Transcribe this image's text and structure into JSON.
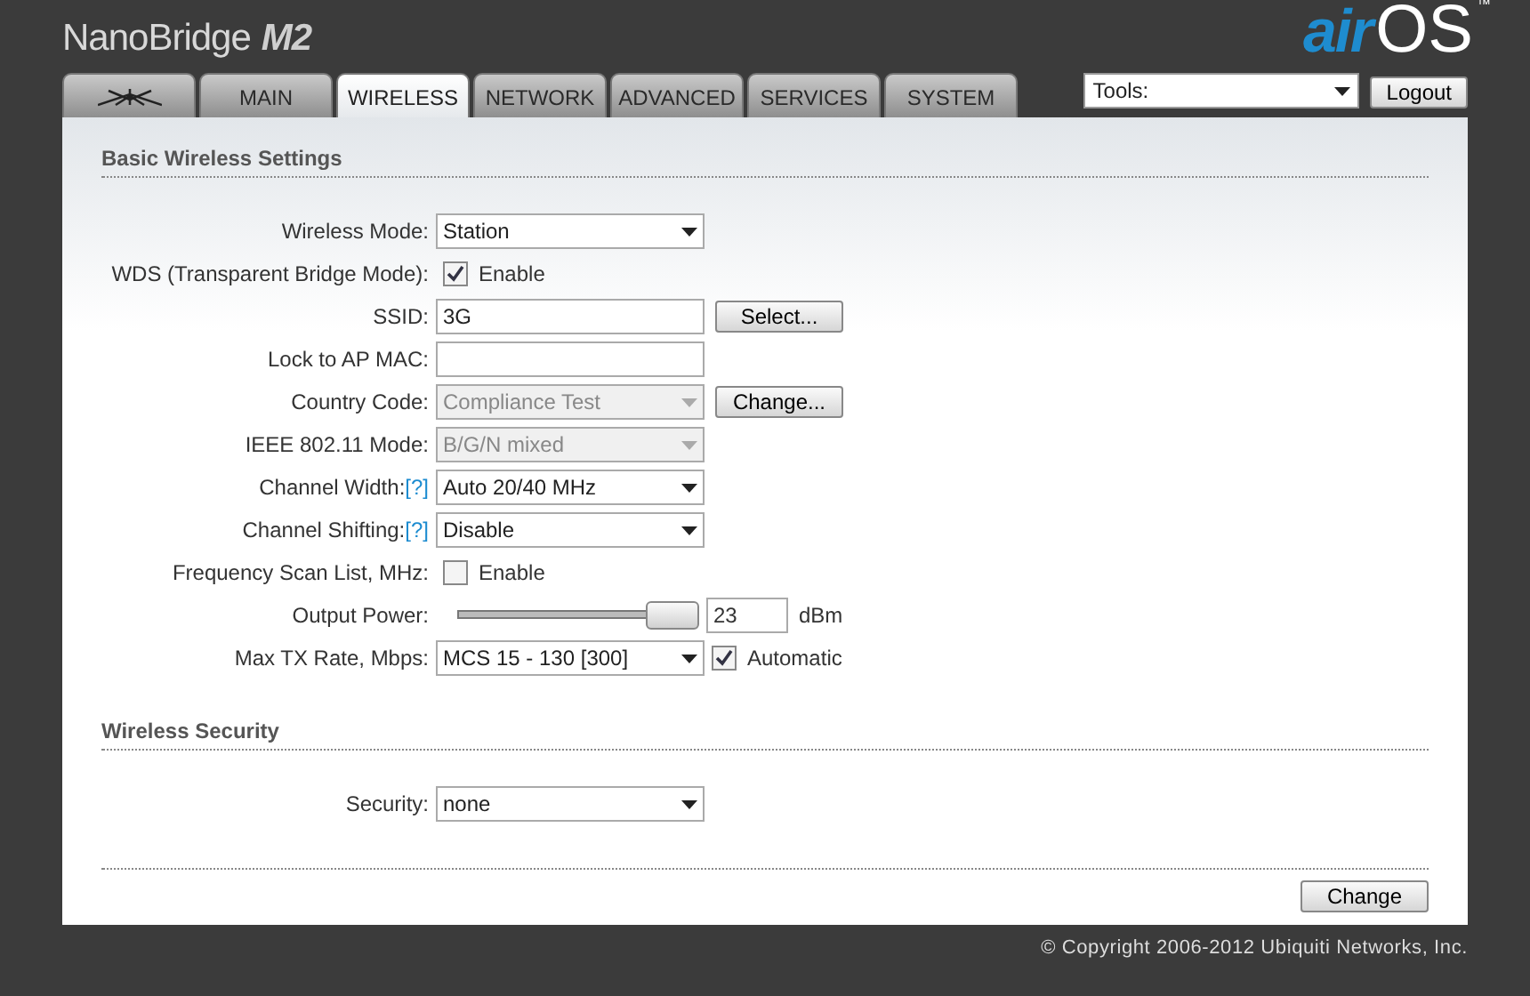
{
  "header": {
    "product": "NanoBridge",
    "model": "M2",
    "logo_air": "air",
    "logo_os": "OS",
    "trademark": "™"
  },
  "tabs": [
    {
      "kind": "logo",
      "selected": false
    },
    {
      "kind": "text",
      "label": "MAIN",
      "selected": false
    },
    {
      "kind": "text",
      "label": "WIRELESS",
      "selected": true
    },
    {
      "kind": "text",
      "label": "NETWORK",
      "selected": false
    },
    {
      "kind": "text",
      "label": "ADVANCED",
      "selected": false
    },
    {
      "kind": "text",
      "label": "SERVICES",
      "selected": false
    },
    {
      "kind": "text",
      "label": "SYSTEM",
      "selected": false
    }
  ],
  "tools": {
    "value": "Tools:",
    "logout": "Logout"
  },
  "sections": [
    {
      "title": "Basic Wireless Settings",
      "rows": [
        {
          "kind": "select",
          "label": "Wireless Mode:",
          "value": "Station",
          "disabled": false
        },
        {
          "kind": "checkbox",
          "label": "WDS (Transparent Bridge Mode):",
          "checked": true,
          "text": "Enable"
        },
        {
          "kind": "text",
          "label": "SSID:",
          "value": "3G",
          "button": "Select..."
        },
        {
          "kind": "text",
          "label": "Lock to AP MAC:"
        },
        {
          "kind": "select",
          "label": "Country Code:",
          "value": "Compliance Test",
          "disabled": true,
          "button": "Change..."
        },
        {
          "kind": "select",
          "label": "IEEE 802.11 Mode:",
          "value": "B/G/N mixed",
          "disabled": true
        },
        {
          "kind": "select",
          "label": "Channel Width:",
          "help": "[?]",
          "value": "Auto 20/40 MHz",
          "disabled": false
        },
        {
          "kind": "select",
          "label": "Channel Shifting:",
          "help": "[?]",
          "value": "Disable",
          "disabled": false
        },
        {
          "kind": "checkbox",
          "label": "Frequency Scan List, MHz:",
          "checked": false,
          "text": "Enable"
        },
        {
          "kind": "slider",
          "label": "Output Power:",
          "level": 1,
          "value": "23",
          "unit": "dBm"
        },
        {
          "kind": "select",
          "label": "Max TX Rate, Mbps:",
          "value": "MCS 15 - 130 [300]",
          "disabled": false,
          "extra": {
            "checked": true,
            "text": "Automatic"
          }
        }
      ]
    },
    {
      "title": "Wireless Security",
      "rows": [
        {
          "kind": "select",
          "label": "Security:",
          "value": "none",
          "disabled": false
        }
      ]
    }
  ],
  "submit": "Change",
  "copyright": "© Copyright 2006-2012 Ubiquiti Networks, Inc."
}
